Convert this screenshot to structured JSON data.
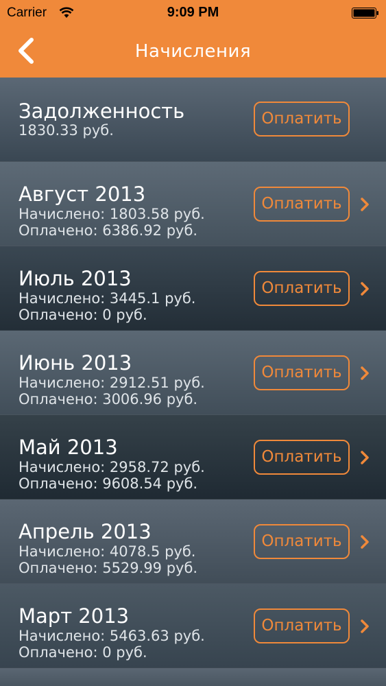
{
  "status_bar": {
    "carrier": "Carrier",
    "time": "9:09 PM",
    "wifi_icon": "wifi-icon",
    "battery_icon": "battery-icon"
  },
  "nav": {
    "title": "Начисления",
    "back_icon": "chevron-left-icon"
  },
  "colors": {
    "accent": "#f0893a",
    "text_primary": "#ffffff",
    "text_secondary": "#dfe4e8"
  },
  "debt": {
    "title": "Задолженность",
    "amount": "1830.33 руб.",
    "pay_label": "Оплатить"
  },
  "months": [
    {
      "title": "Август 2013",
      "accrued": "Начислено: 1803.58 руб.",
      "paid": "Оплачено: 6386.92 руб.",
      "pay_label": "Оплатить"
    },
    {
      "title": "Июль 2013",
      "accrued": "Начислено: 3445.1 руб.",
      "paid": "Оплачено: 0 руб.",
      "pay_label": "Оплатить"
    },
    {
      "title": "Июнь 2013",
      "accrued": "Начислено: 2912.51 руб.",
      "paid": "Оплачено: 3006.96 руб.",
      "pay_label": "Оплатить"
    },
    {
      "title": "Май 2013",
      "accrued": "Начислено: 2958.72 руб.",
      "paid": "Оплачено: 9608.54 руб.",
      "pay_label": "Оплатить"
    },
    {
      "title": "Апрель 2013",
      "accrued": "Начислено: 4078.5 руб.",
      "paid": "Оплачено: 5529.99 руб.",
      "pay_label": "Оплатить"
    },
    {
      "title": "Март 2013",
      "accrued": "Начислено: 5463.63 руб.",
      "paid": "Оплачено: 0 руб.",
      "pay_label": "Оплатить"
    }
  ]
}
